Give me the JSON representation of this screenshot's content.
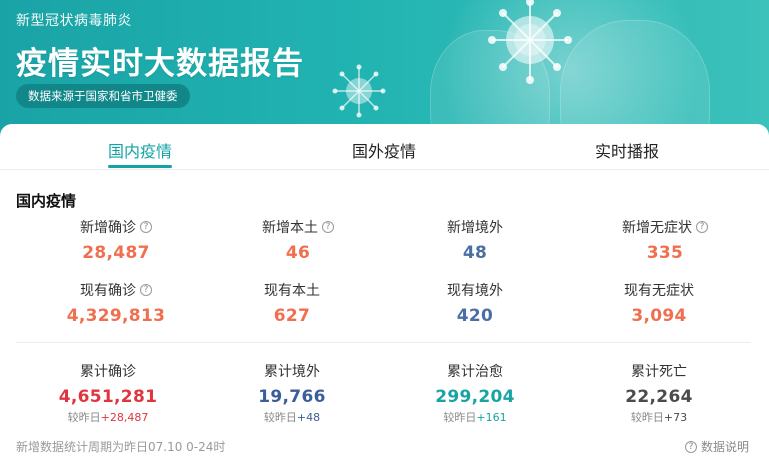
{
  "banner": {
    "subtitle": "新型冠状病毒肺炎",
    "title": "疫情实时大数据报告",
    "source": "数据来源于国家和省市卫健委"
  },
  "tabs": [
    {
      "label": "国内疫情",
      "active": true
    },
    {
      "label": "国外疫情",
      "active": false
    },
    {
      "label": "实时播报",
      "active": false
    }
  ],
  "section_title": "国内疫情",
  "stats": {
    "row1": [
      {
        "label": "新增确诊",
        "value": "28,487",
        "help": true
      },
      {
        "label": "新增本土",
        "value": "46",
        "help": true
      },
      {
        "label": "新增境外",
        "value": "48",
        "help": false
      },
      {
        "label": "新增无症状",
        "value": "335",
        "help": true
      }
    ],
    "row2": [
      {
        "label": "现有确诊",
        "value": "4,329,813",
        "help": true
      },
      {
        "label": "现有本土",
        "value": "627",
        "help": false
      },
      {
        "label": "现有境外",
        "value": "420",
        "help": false
      },
      {
        "label": "现有无症状",
        "value": "3,094",
        "help": false
      }
    ],
    "row3": [
      {
        "label": "累计确诊",
        "value": "4,651,281",
        "sub_prefix": "较昨日",
        "sub_delta": "+28,487"
      },
      {
        "label": "累计境外",
        "value": "19,766",
        "sub_prefix": "较昨日",
        "sub_delta": "+48"
      },
      {
        "label": "累计治愈",
        "value": "299,204",
        "sub_prefix": "较昨日",
        "sub_delta": "+161"
      },
      {
        "label": "累计死亡",
        "value": "22,264",
        "sub_prefix": "较昨日",
        "sub_delta": "+73"
      }
    ]
  },
  "help_glyph": "?",
  "footnote": "新增数据统计周期为昨日07.10 0-24时",
  "explain_label": "数据说明",
  "colors": {
    "accent": "#13a3a6",
    "orange": "#f06f4f",
    "blue": "#4a6fa5",
    "red": "#e0353e",
    "teal": "#18a3a5"
  },
  "icons": [
    "virus-icon",
    "help-icon"
  ]
}
